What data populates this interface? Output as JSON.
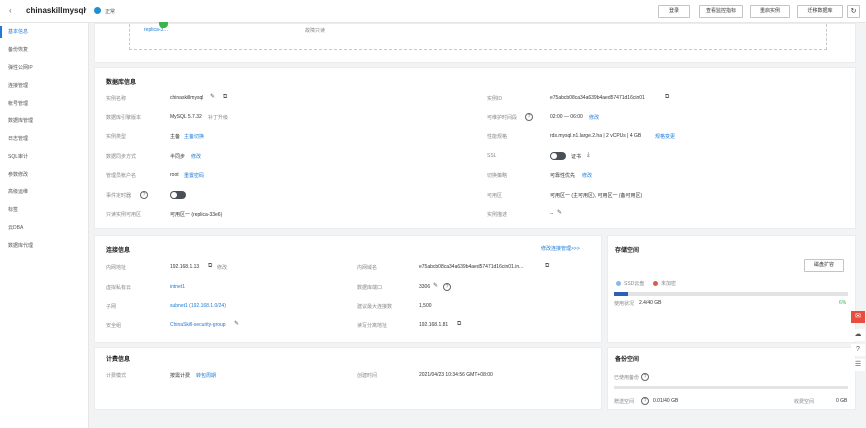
{
  "header": {
    "back_icon": "‹",
    "title": "chinaskillmysql",
    "caret": "▾",
    "status": "正常",
    "buttons": [
      "登录",
      "查看监控指标",
      "重启实例",
      "迁移数据库"
    ],
    "refresh_icon": "↻"
  },
  "sidebar": {
    "items": [
      "基本信息",
      "备份恢复",
      "弹性公网IP",
      "连接管理",
      "帐号管理",
      "数据库管理",
      "日志管理",
      "SQL审计",
      "参数修改",
      "高级运维",
      "标签",
      "云DBA",
      "数据库代理"
    ]
  },
  "topology": {
    "replica_label": "replica-3…",
    "standby_label": "故障只读"
  },
  "db_info": {
    "title": "数据库信息",
    "left": [
      {
        "label": "实例名称",
        "value": "chinaskillmysql"
      },
      {
        "label": "数据库引擎版本",
        "value": "MySQL 5.7.32",
        "link": "补丁升级"
      },
      {
        "label": "实例类型",
        "value": "主备",
        "link": "主备切换"
      },
      {
        "label": "数据同步方式",
        "value": "半同步",
        "link": "修改"
      },
      {
        "label": "管理员帐户名",
        "value": "root",
        "link": "重置密码"
      },
      {
        "label": "事件定时器",
        "value": ""
      },
      {
        "label": "只读实例可用区",
        "value": "可用区一 (replica-33e6)"
      }
    ],
    "right": [
      {
        "label": "实例ID",
        "value": "e75abcb08ca34a639b4aed57471d16cin01"
      },
      {
        "label": "可维护时间段",
        "value": "02:00 — 06:00",
        "link": "修改"
      },
      {
        "label": "性能规格",
        "value": "rds.mysql.n1.large.2.ha | 2 vCPUs | 4 GB",
        "link": "规格变更"
      },
      {
        "label": "SSL",
        "value": "证书"
      },
      {
        "label": "切换策略",
        "value": "可靠性优先",
        "link": "修改"
      },
      {
        "label": "可用区",
        "value": "可用区一 (主可用区), 可用区一 (备可用区)"
      },
      {
        "label": "实例描述",
        "value": "--"
      }
    ]
  },
  "conn_info": {
    "title": "连接信息",
    "top_link": "修改连接管理>>>",
    "left": [
      {
        "label": "内网地址",
        "value": "192.168.1.13",
        "link": "修改"
      },
      {
        "label": "虚拟私有云",
        "value": "",
        "link": "intnet1"
      },
      {
        "label": "子网",
        "value": "",
        "link": "subnet1 (192.168.1.0/24)"
      },
      {
        "label": "安全组",
        "value": "",
        "link": "ChinaSkill-security-group"
      }
    ],
    "right": [
      {
        "label": "内网域名",
        "value": "e75abcb08ca34a639b4aed57471d16cin01.in..."
      },
      {
        "label": "数据库端口",
        "value": "3306"
      },
      {
        "label": "建议最大连接数",
        "value": "1,500"
      },
      {
        "label": "读写分离地址",
        "value": "192.168.1.81"
      }
    ]
  },
  "billing": {
    "title": "计费信息",
    "label": "计费模式",
    "value": "按需计费",
    "link": "转包周期",
    "created_label": "创建时间",
    "created_value": "2021/04/23 10:34:56 GMT+08:00"
  },
  "storage": {
    "title": "存储空间",
    "expand_button": "磁盘扩容",
    "disk_type": "SSD云盘",
    "encrypt": "未加密",
    "usage_label": "使用状况",
    "usage_value": "2.4/40 GB",
    "usage_fraction": 0.06,
    "percent": "6%"
  },
  "backup": {
    "title": "备份空间",
    "used_label": "已使用备份",
    "free_label": "赠送空间",
    "free_value": "0.01/40 GB",
    "charge_label": "收费空间",
    "charge_value": "0 GB"
  },
  "float_icons": [
    "message-icon",
    "cloud-icon",
    "help-icon",
    "doc-icon"
  ],
  "colors": {
    "accent": "#1e7ad6",
    "status": "#1e8fd0",
    "danger": "#e84e40"
  }
}
